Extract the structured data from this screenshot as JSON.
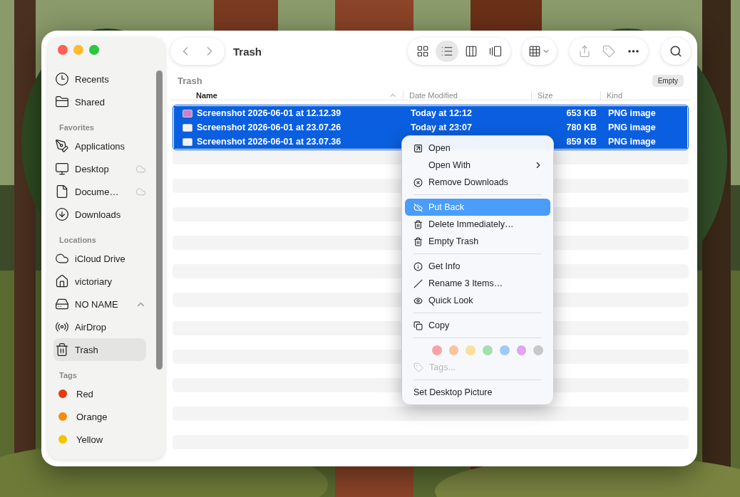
{
  "window": {
    "title": "Trash",
    "path_label": "Trash",
    "empty_button": "Empty"
  },
  "sidebar": [
    {
      "items": [
        {
          "label": "Recents",
          "kind": "clock",
          "selected": false
        },
        {
          "label": "Shared",
          "kind": "shared",
          "selected": false
        }
      ]
    },
    {
      "heading": "Favorites",
      "items": [
        {
          "label": "Applications",
          "kind": "apps",
          "selected": false
        },
        {
          "label": "Desktop",
          "kind": "desktop",
          "selected": false,
          "cloud": true
        },
        {
          "label": "Docume…",
          "kind": "document",
          "selected": false,
          "cloud": true
        },
        {
          "label": "Downloads",
          "kind": "download",
          "selected": false
        }
      ]
    },
    {
      "heading": "Locations",
      "items": [
        {
          "label": "iCloud Drive",
          "kind": "cloud",
          "selected": false
        },
        {
          "label": "victoriary",
          "kind": "home",
          "selected": false
        },
        {
          "label": "NO NAME",
          "kind": "drive",
          "selected": false,
          "eject": true
        },
        {
          "label": "AirDrop",
          "kind": "airdrop",
          "selected": false
        },
        {
          "label": "Trash",
          "kind": "trash",
          "selected": true
        }
      ]
    },
    {
      "heading": "Tags",
      "items": [
        {
          "label": "Red",
          "kind": "tag",
          "selected": false,
          "color": "#e8380d"
        },
        {
          "label": "Orange",
          "kind": "tag",
          "selected": false,
          "color": "#f0900a"
        },
        {
          "label": "Yellow",
          "kind": "tag",
          "selected": false,
          "color": "#f2c500"
        }
      ]
    }
  ],
  "toolbar": {
    "views": [
      {
        "selected": false
      },
      {
        "selected": true
      },
      {
        "selected": false
      },
      {
        "selected": false
      }
    ]
  },
  "table": {
    "columns": [
      "Name",
      "Date Modified",
      "Size",
      "Kind"
    ],
    "rows": [
      {
        "name": "Screenshot 2026-06-01 at 12.12.39",
        "date": "Today at 12:12",
        "size": "653 KB",
        "kind": "PNG image",
        "selected": true
      },
      {
        "name": "Screenshot 2026-06-01 at 23.07.26",
        "date": "Today at 23:07",
        "size": "780 KB",
        "kind": "PNG image",
        "selected": true
      },
      {
        "name": "Screenshot 2026-06-01 at 23.07.36",
        "size": "859 KB",
        "kind": "PNG image",
        "selected": true
      }
    ]
  },
  "context_menu": [
    [
      {
        "kind": "open",
        "label": "Open",
        "selected": false
      },
      {
        "kind": "submenu",
        "label": "Open With",
        "selected": false
      },
      {
        "kind": "remove",
        "label": "Remove Downloads",
        "selected": false
      }
    ],
    [
      {
        "kind": "putback",
        "label": "Put Back",
        "selected": true
      },
      {
        "kind": "trash",
        "label": "Delete Immediately…",
        "selected": false
      },
      {
        "kind": "trash",
        "label": "Empty Trash",
        "selected": false
      }
    ],
    [
      {
        "kind": "info",
        "label": "Get Info",
        "selected": false
      },
      {
        "kind": "rename",
        "label": "Rename 3 Items…",
        "selected": false
      },
      {
        "kind": "eye",
        "label": "Quick Look",
        "selected": false
      }
    ],
    [
      {
        "kind": "copy",
        "label": "Copy",
        "selected": false
      }
    ],
    [
      {
        "kind": "colors",
        "colors": [
          {
            "color": "#f7a3a6"
          },
          {
            "color": "#f9c39c"
          },
          {
            "color": "#fbe09a"
          },
          {
            "color": "#a5dfae"
          },
          {
            "color": "#9ecbfb"
          },
          {
            "color": "#e0a6ef"
          },
          {
            "color": "#c8c8ca"
          }
        ]
      },
      {
        "kind": "tags",
        "label": "Tags...",
        "disabled": true
      }
    ],
    [
      {
        "kind": "plain",
        "label": "Set Desktop Picture",
        "selected": false
      }
    ]
  ]
}
